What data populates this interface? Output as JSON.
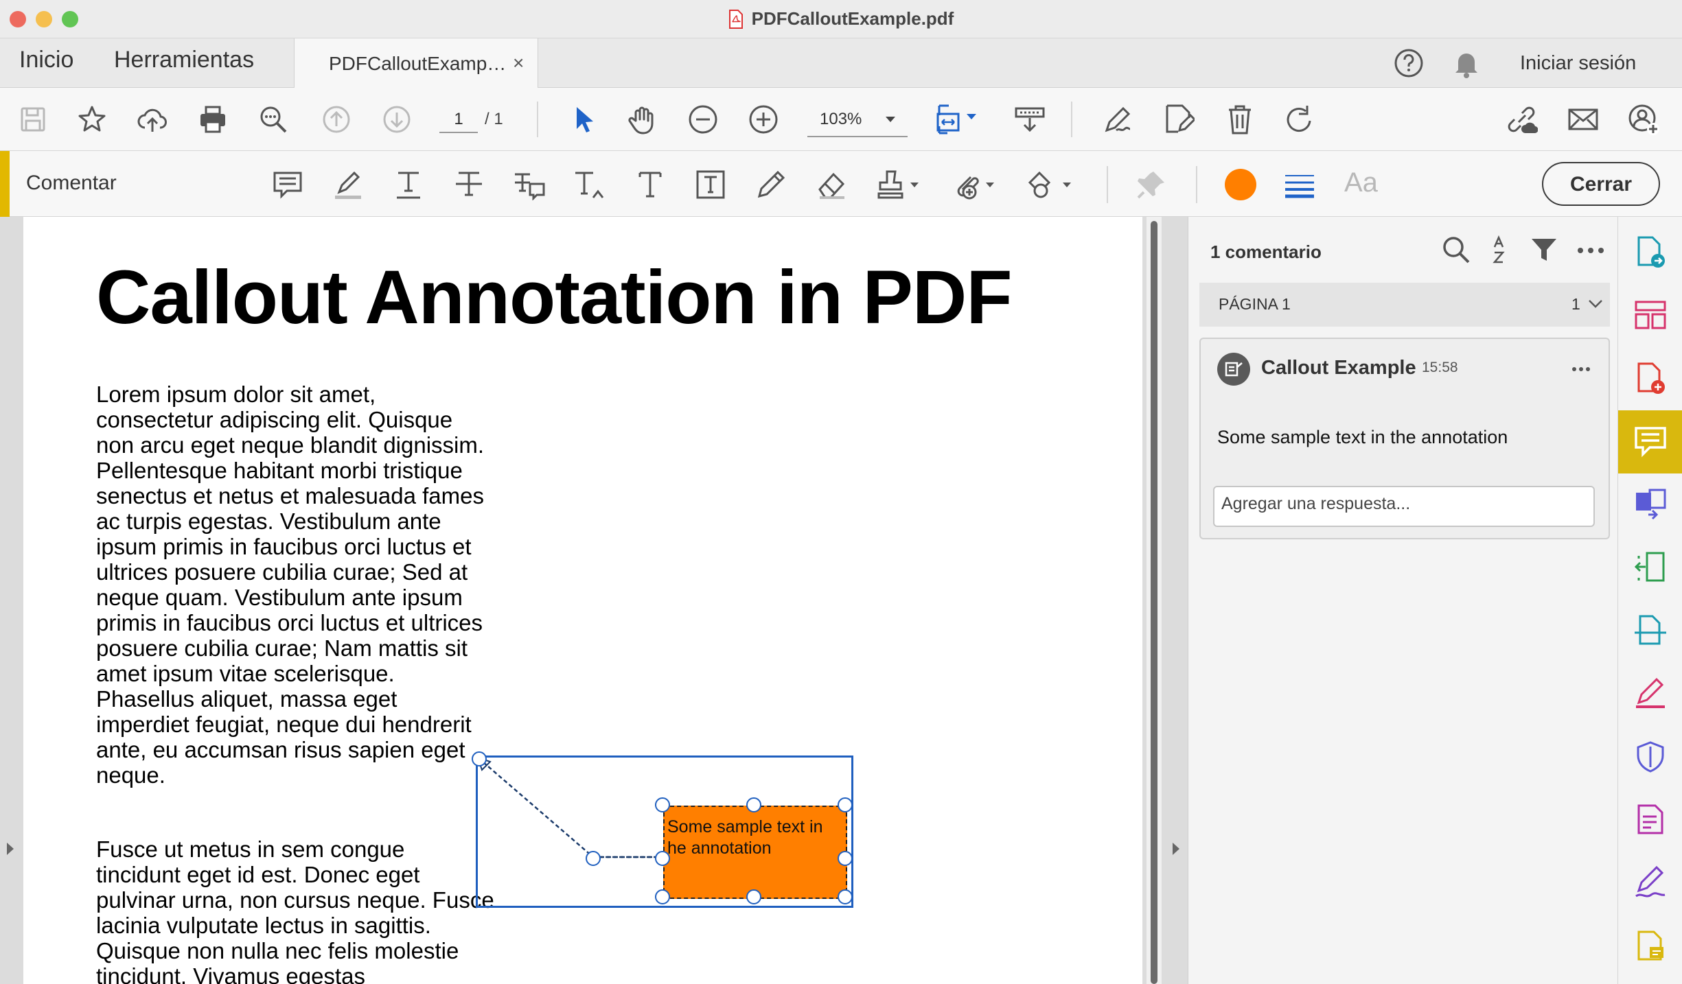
{
  "window": {
    "title": "PDFCalloutExample.pdf",
    "traffic_lights": [
      "#ed6a5e",
      "#f5bf4f",
      "#61c554"
    ]
  },
  "tabs": {
    "home": "Inicio",
    "tools": "Herramientas",
    "document": "PDFCalloutExamp…",
    "close_glyph": "×"
  },
  "header": {
    "signin": "Iniciar sesión"
  },
  "toolbar": {
    "page_current": "1",
    "page_total": "/ 1",
    "zoom": "103%"
  },
  "comment_toolbar": {
    "label": "Comentar",
    "font_label": "Aa",
    "close_label": "Cerrar",
    "color": "#ff7f00"
  },
  "document": {
    "title": "Callout Annotation in PDF",
    "paragraph_1": "Lorem ipsum dolor sit amet, consectetur adipiscing elit. Quisque non arcu eget neque blandit dignissim. Pellentesque habitant morbi tristique senectus et netus et malesuada fames ac turpis egestas. Vestibulum ante ipsum primis in faucibus orci luctus et ultrices posuere cubilia curae; Sed at neque quam. Vestibulum ante ipsum primis in faucibus orci luctus et ultrices posuere cubilia curae; Nam mattis sit amet ipsum vitae scelerisque. Phasellus aliquet, massa eget imperdiet feugiat, neque dui hendrerit ante, eu accumsan risus sapien eget neque.",
    "paragraph_2": "Fusce ut metus in sem congue tincidunt eget id est. Donec eget pulvinar urna, non cursus neque. Fusce lacinia vulputate lectus in sagittis. Quisque non nulla nec felis molestie tincidunt. Vivamus egestas",
    "callout": {
      "line_1": "Some sample text in",
      "line_2": "he annotation",
      "fill": "#ff7f00",
      "frame_color": "#1f5fbf"
    }
  },
  "comments_pane": {
    "count_label": "1 comentario",
    "page_label": "PÁGINA 1",
    "page_count": "1",
    "comment": {
      "author": "Callout Example",
      "time": "15:58",
      "text": "Some sample text in the annotation",
      "reply_placeholder": "Agregar una respuesta..."
    }
  },
  "tools_rail": {
    "icons": [
      "export-pdf-icon",
      "organize-pages-icon",
      "create-pdf-icon",
      "comment-icon",
      "combine-files-icon",
      "compress-icon",
      "scan-ocr-icon",
      "fill-sign-icon",
      "protect-icon",
      "prepare-form-icon",
      "request-signature-icon",
      "more-tools-icon"
    ],
    "active_color": "#d9b80e"
  }
}
